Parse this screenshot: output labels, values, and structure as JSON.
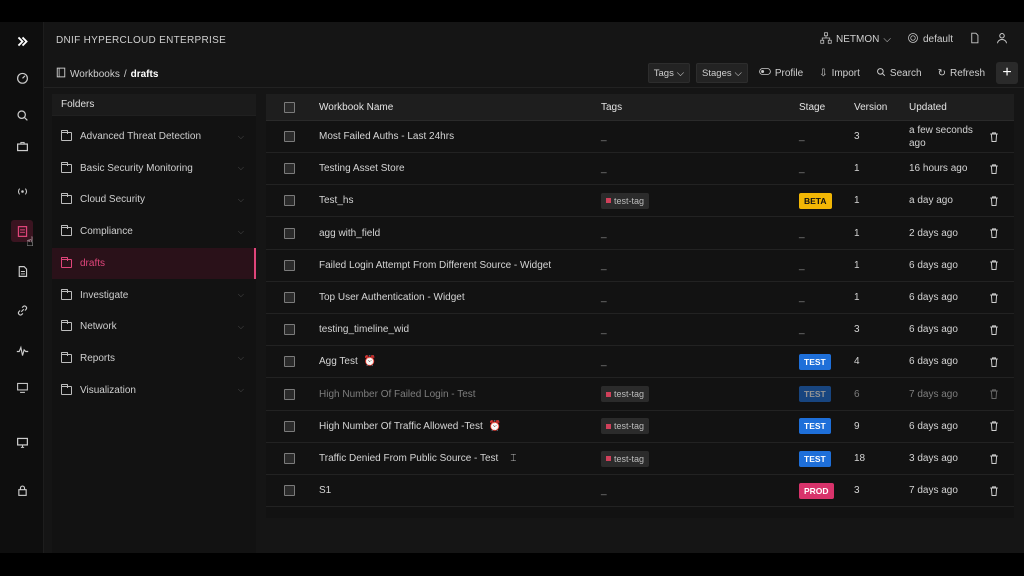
{
  "app": {
    "brand": "DNIF HYPERCLOUD ENTERPRISE",
    "workspace": "NETMON",
    "profile": "default"
  },
  "breadcrumb": {
    "root": "Workbooks",
    "separator": "/",
    "current": "drafts"
  },
  "toolbar": {
    "tags_label": "Tags",
    "stages_label": "Stages",
    "profile_label": "Profile",
    "import_label": "Import",
    "search_label": "Search",
    "refresh_label": "Refresh",
    "add_label": "+"
  },
  "folders": {
    "title": "Folders",
    "items": [
      {
        "label": "Advanced Threat Detection",
        "active": false
      },
      {
        "label": "Basic Security Monitoring",
        "active": false
      },
      {
        "label": "Cloud Security",
        "active": false
      },
      {
        "label": "Compliance",
        "active": false
      },
      {
        "label": "drafts",
        "active": true
      },
      {
        "label": "Investigate",
        "active": false
      },
      {
        "label": "Network",
        "active": false
      },
      {
        "label": "Reports",
        "active": false
      },
      {
        "label": "Visualization",
        "active": false
      }
    ]
  },
  "table": {
    "headers": {
      "name": "Workbook Name",
      "tags": "Tags",
      "stage": "Stage",
      "version": "Version",
      "updated": "Updated"
    },
    "rows": [
      {
        "name": "Most Failed Auths - Last 24hrs",
        "tag": "_",
        "stage": "_",
        "version": "3",
        "updated": "a few seconds ago",
        "dim": false
      },
      {
        "name": "Testing Asset Store",
        "tag": "_",
        "stage": "_",
        "version": "1",
        "updated": "16 hours ago",
        "dim": false
      },
      {
        "name": "Test_hs",
        "tag": "test-tag",
        "stage": "BETA",
        "version": "1",
        "updated": "a day ago",
        "dim": false
      },
      {
        "name": "agg with_field",
        "tag": "_",
        "stage": "_",
        "version": "1",
        "updated": "2 days ago",
        "dim": false
      },
      {
        "name": "Failed Login Attempt From Different Source - Widget",
        "tag": "_",
        "stage": "_",
        "version": "1",
        "updated": "6 days ago",
        "dim": false
      },
      {
        "name": "Top User Authentication - Widget",
        "tag": "_",
        "stage": "_",
        "version": "1",
        "updated": "6 days ago",
        "dim": false
      },
      {
        "name": "testing_timeline_wid",
        "tag": "_",
        "stage": "_",
        "version": "3",
        "updated": "6 days ago",
        "dim": false
      },
      {
        "name": "Agg Test",
        "tag": "_",
        "stage": "TEST",
        "version": "4",
        "updated": "6 days ago",
        "dim": false,
        "clock": true
      },
      {
        "name": "High Number Of Failed Login - Test",
        "tag": "test-tag",
        "stage": "TEST",
        "version": "6",
        "updated": "7 days ago",
        "dim": true
      },
      {
        "name": "High Number Of Traffic Allowed -Test",
        "tag": "test-tag",
        "stage": "TEST",
        "version": "9",
        "updated": "6 days ago",
        "dim": false,
        "clock": true
      },
      {
        "name": "Traffic Denied From Public Source - Test",
        "tag": "test-tag",
        "stage": "TEST",
        "version": "18",
        "updated": "3 days ago",
        "dim": false,
        "cursor": true
      },
      {
        "name": "S1",
        "tag": "_",
        "stage": "PROD",
        "version": "3",
        "updated": "7 days ago",
        "dim": false
      }
    ]
  },
  "colors": {
    "accent": "#e0457a",
    "beta": "#f2b705",
    "test": "#1e6fd9",
    "prod": "#d8336b"
  }
}
